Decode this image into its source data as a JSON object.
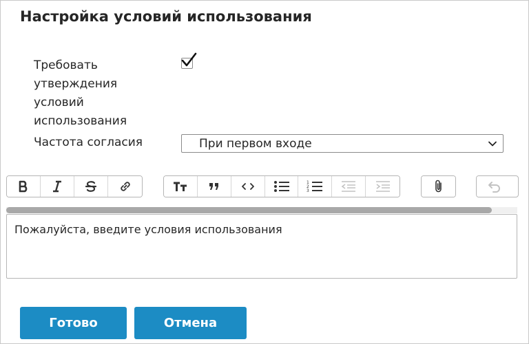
{
  "dialog": {
    "title": "Настройка условий использования"
  },
  "form": {
    "require_label": "Требовать утверждения условий использования",
    "require_checked": true,
    "frequency_label": "Частота согласия",
    "frequency_value": "При первом входе"
  },
  "toolbar": {
    "groups": [
      [
        "bold-icon",
        "italic-icon",
        "strikethrough-icon",
        "link-icon"
      ],
      [
        "heading-icon",
        "quote-icon",
        "code-icon",
        "bullet-list-icon",
        "numbered-list-icon",
        "outdent-icon",
        "indent-icon"
      ],
      [
        "attachment-icon"
      ],
      [
        "undo-icon"
      ]
    ]
  },
  "editor": {
    "placeholder": "Пожалуйста, введите условия использования"
  },
  "buttons": {
    "done_label": "Готово",
    "cancel_label": "Отмена"
  },
  "colors": {
    "accent": "#1c8cc4"
  }
}
